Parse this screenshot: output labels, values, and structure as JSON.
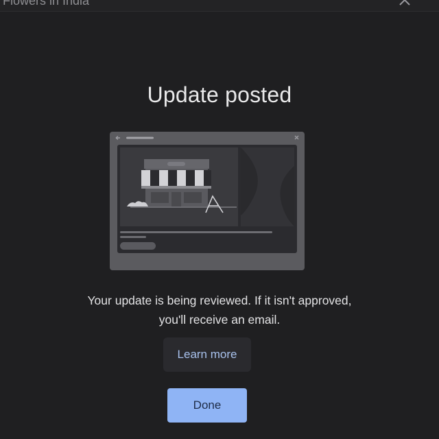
{
  "header": {
    "title": "Flowers in India"
  },
  "dialog": {
    "title": "Update posted",
    "message_line1": "Your update is being reviewed. If it isn't approved,",
    "message_line2": "you'll receive an email.",
    "learn_more_label": "Learn more",
    "done_label": "Done"
  },
  "icons": {
    "close": "close-icon",
    "illustration": "storefront-browser-illustration"
  },
  "colors": {
    "background": "#1f1f21",
    "primary_button": "#8fb4f5",
    "link_text": "#a9c2ee",
    "text": "#e3e3e5"
  }
}
